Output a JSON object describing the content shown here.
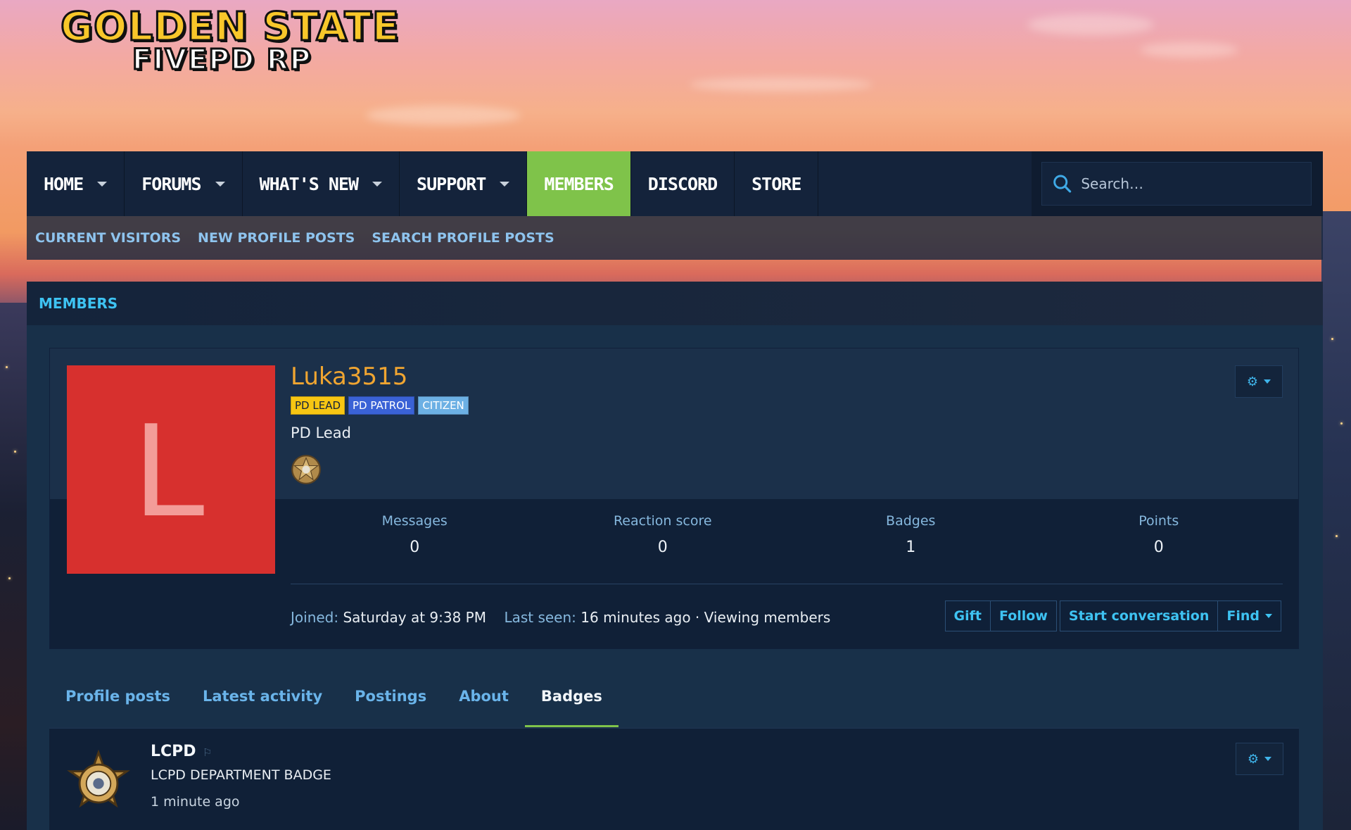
{
  "logo": {
    "line1": "GOLDEN STATE",
    "line2": "FIVEPD RP"
  },
  "nav": {
    "items": [
      {
        "label": "HOME",
        "has_menu": true
      },
      {
        "label": "FORUMS",
        "has_menu": true
      },
      {
        "label": "WHAT'S NEW",
        "has_menu": true
      },
      {
        "label": "SUPPORT",
        "has_menu": true
      },
      {
        "label": "MEMBERS",
        "has_menu": false,
        "active": true
      },
      {
        "label": "DISCORD",
        "has_menu": false
      },
      {
        "label": "STORE",
        "has_menu": false
      }
    ],
    "search_placeholder": "Search…"
  },
  "subnav": {
    "items": [
      "CURRENT VISITORS",
      "NEW PROFILE POSTS",
      "SEARCH PROFILE POSTS"
    ]
  },
  "breadcrumb": "MEMBERS",
  "profile": {
    "avatar_letter": "L",
    "username": "Luka3515",
    "banners": [
      "PD LEAD",
      "PD PATROL",
      "CITIZEN"
    ],
    "user_title": "PD Lead",
    "stats": [
      {
        "label": "Messages",
        "value": "0"
      },
      {
        "label": "Reaction score",
        "value": "0"
      },
      {
        "label": "Badges",
        "value": "1"
      },
      {
        "label": "Points",
        "value": "0"
      }
    ],
    "joined_label": "Joined:",
    "joined_value": "Saturday at 9:38 PM",
    "last_seen_label": "Last seen:",
    "last_seen_value": "16 minutes ago · Viewing members",
    "actions": {
      "gift": "Gift",
      "follow": "Follow",
      "start_conversation": "Start conversation",
      "find": "Find"
    }
  },
  "tabs": [
    {
      "label": "Profile posts"
    },
    {
      "label": "Latest activity"
    },
    {
      "label": "Postings"
    },
    {
      "label": "About"
    },
    {
      "label": "Badges",
      "active": true
    }
  ],
  "badge_list": [
    {
      "name": "LCPD",
      "description": "LCPD DEPARTMENT BADGE",
      "time": "1 minute ago"
    }
  ],
  "colors": {
    "accent_blue": "#3ec3f2",
    "active_green": "#7fc34a",
    "username_orange": "#f0a531",
    "nav_bg": "#14233b",
    "avatar_red": "#d7302e"
  },
  "icons": [
    "search-icon",
    "caret-down-icon",
    "gear-icon",
    "pin-icon",
    "sheriff-star-badge-icon"
  ]
}
